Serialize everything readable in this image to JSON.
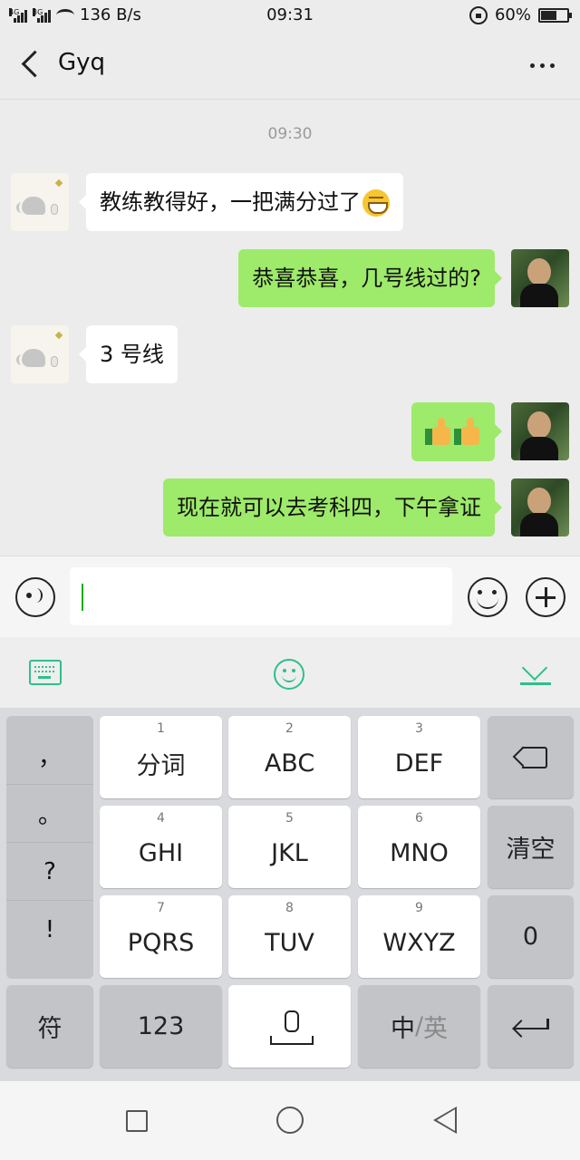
{
  "status_bar": {
    "network_label_1": "4G",
    "network_label_2": "3G",
    "speed": "136 B/s",
    "time": "09:31",
    "battery_text": "60%",
    "battery_level": 0.6
  },
  "header": {
    "title": "Gyq",
    "back_icon": "back-arrow-icon",
    "more_icon": "more-dots-icon"
  },
  "chat": {
    "timestamp": "09:30",
    "messages": [
      {
        "sender": "other",
        "text": "教练教得好，一把满分过了",
        "emoji": "grin-emoji"
      },
      {
        "sender": "me",
        "text": "恭喜恭喜，几号线过的?"
      },
      {
        "sender": "other",
        "text": "3 号线"
      },
      {
        "sender": "me",
        "text": "",
        "emoji": "thumbs-up-emoji x2"
      },
      {
        "sender": "me",
        "text": "现在就可以去考科四，下午拿证"
      }
    ]
  },
  "input_bar": {
    "voice_icon": "voice-icon",
    "text_value": "",
    "emoji_icon": "emoji-icon",
    "plus_icon": "plus-icon"
  },
  "keyboard_toolbar": {
    "keyboard_icon": "keyboard-icon",
    "emoji_icon": "smile-icon",
    "collapse_icon": "collapse-keyboard-icon",
    "accent_color": "#2fbf8a"
  },
  "keyboard": {
    "punctuation": [
      "，",
      "。",
      "?",
      "!"
    ],
    "row1": [
      {
        "num": "1",
        "label": "分词"
      },
      {
        "num": "2",
        "label": "ABC"
      },
      {
        "num": "3",
        "label": "DEF"
      }
    ],
    "row2": [
      {
        "num": "4",
        "label": "GHI"
      },
      {
        "num": "5",
        "label": "JKL"
      },
      {
        "num": "6",
        "label": "MNO"
      }
    ],
    "row3": [
      {
        "num": "7",
        "label": "PQRS"
      },
      {
        "num": "8",
        "label": "TUV"
      },
      {
        "num": "9",
        "label": "WXYZ"
      }
    ],
    "clear": "清空",
    "zero": "0",
    "symbols": "符",
    "numbers": "123",
    "lang_zh": "中",
    "lang_sep": "/",
    "lang_en": "英",
    "backspace_icon": "backspace-icon",
    "mic_icon": "mic-icon",
    "enter_icon": "enter-icon"
  },
  "nav_bar": {
    "recent_icon": "square-icon",
    "home_icon": "circle-icon",
    "back_icon": "triangle-back-icon"
  },
  "colors": {
    "my_bubble": "#9eea6a",
    "other_bubble": "#ffffff",
    "caret": "#1aad19"
  }
}
